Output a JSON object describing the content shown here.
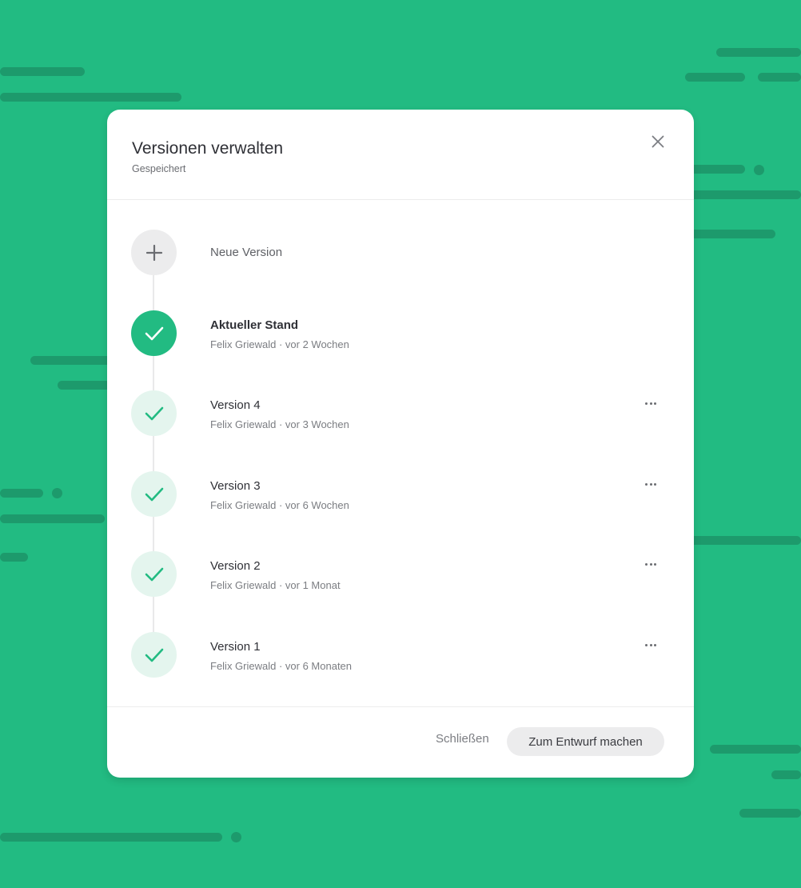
{
  "modal": {
    "title": "Versionen verwalten",
    "subtitle": "Gespeichert"
  },
  "new_version": {
    "label": "Neue Version"
  },
  "versions": [
    {
      "title": "Aktueller Stand",
      "meta": "Felix Griewald · vor 2 Wochen",
      "status": "current"
    },
    {
      "title": "Version 4",
      "meta": "Felix Griewald · vor 3 Wochen",
      "status": "saved"
    },
    {
      "title": "Version 3",
      "meta": "Felix Griewald · vor 6 Wochen",
      "status": "saved"
    },
    {
      "title": "Version 2",
      "meta": "Felix Griewald · vor 1 Monat",
      "status": "saved"
    },
    {
      "title": "Version 1",
      "meta": "Felix Griewald · vor 6 Monaten",
      "status": "saved"
    }
  ],
  "footer": {
    "close_label": "Schließen",
    "draft_label": "Zum Entwurf machen"
  },
  "colors": {
    "background": "#22bb82",
    "accent": "#22bb82",
    "accent_light": "#e4f5ee"
  },
  "icons": [
    "close-icon",
    "plus-icon",
    "check-icon",
    "more-icon"
  ]
}
